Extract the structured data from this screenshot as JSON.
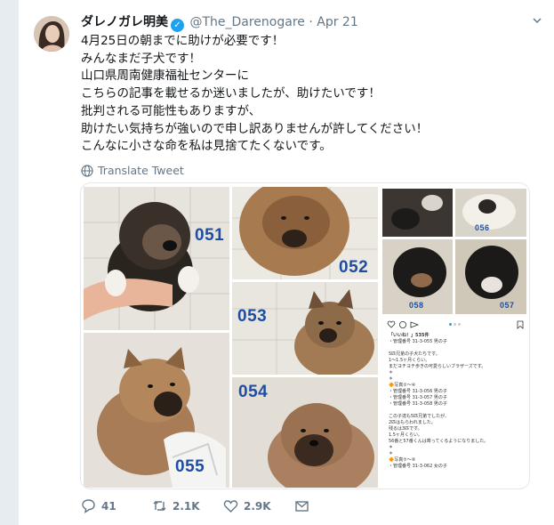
{
  "tweet": {
    "display_name": "ダレノガレ明美",
    "handle": "@The_Darenogare",
    "separator": "·",
    "date": "Apr 21",
    "lines": [
      "4月25日の朝までに助けが必要です！",
      "みんなまだ子犬です！",
      "山口県周南健康福祉センターに",
      "こちらの記事を載せるか迷いましたが、助けたいです！",
      "批判される可能性もありますが、",
      "助けたい気持ちが強いので申し訳ありませんが許してください！",
      "こんなに小さな命を私は見捨てたくないです。"
    ],
    "translate_label": "Translate Tweet"
  },
  "media": {
    "labels": {
      "p051": "051",
      "p052": "052",
      "p053": "053",
      "p054": "054",
      "p055": "055",
      "p056": "056",
      "p057": "057",
      "p058": "058"
    },
    "insta_lines": [
      "「いいね！」535件",
      "・管理番号 31-3-055 男の子",
      "",
      "5匹兄弟の子犬たちです。",
      "1〜1.5ヶ月くらい。",
      "まだヨチヨチ歩きの可愛らしいブラザーズです。",
      "＊",
      "＊",
      "🔶写真②〜④",
      "・管理番号 31-3-056 男の子",
      "・管理番号 31-3-057 男の子",
      "・管理番号 31-3-058 男の子",
      "",
      "この子達も5匹兄弟でしたが、",
      "2匹はもらわれました。",
      "残るは3匹です。",
      "1.5ヶ月くらい。",
      "56番と57番くんは寄ってくるようになりました。",
      "＊",
      "＊",
      "🔶写真⑦〜⑨",
      "・管理番号 31-3-062 女の子"
    ]
  },
  "actions": {
    "replies": "41",
    "retweets": "2.1K",
    "likes": "2.9K"
  },
  "colors": {
    "accent": "#1da1f2",
    "label_blue": "#1d4ea3",
    "muted": "#657786"
  }
}
